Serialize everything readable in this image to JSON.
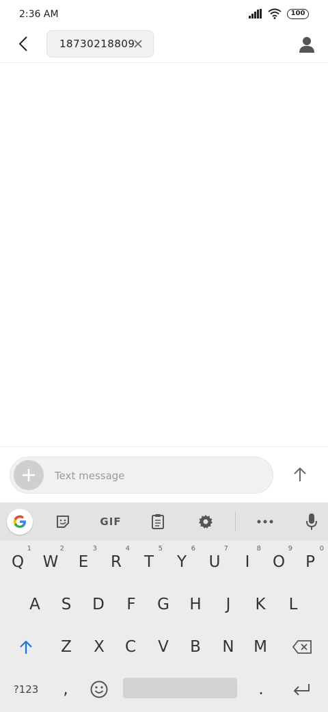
{
  "status_bar": {
    "time": "2:36 AM",
    "battery": "100"
  },
  "header": {
    "recipient": "18730218809"
  },
  "compose": {
    "placeholder": "Text message"
  },
  "keyboard": {
    "toolbar": {
      "gif_label": "GIF"
    },
    "row1": [
      {
        "letter": "Q",
        "hint": "1"
      },
      {
        "letter": "W",
        "hint": "2"
      },
      {
        "letter": "E",
        "hint": "3"
      },
      {
        "letter": "R",
        "hint": "4"
      },
      {
        "letter": "T",
        "hint": "5"
      },
      {
        "letter": "Y",
        "hint": "6"
      },
      {
        "letter": "U",
        "hint": "7"
      },
      {
        "letter": "I",
        "hint": "8"
      },
      {
        "letter": "O",
        "hint": "9"
      },
      {
        "letter": "P",
        "hint": "0"
      }
    ],
    "row2": [
      "A",
      "S",
      "D",
      "F",
      "G",
      "H",
      "J",
      "K",
      "L"
    ],
    "row3": [
      "Z",
      "X",
      "C",
      "V",
      "B",
      "N",
      "M"
    ],
    "row4": {
      "symbols": "?123",
      "comma": ",",
      "period": "."
    }
  },
  "colors": {
    "accent": "#1a73e8",
    "keyboard_bg": "#ececec",
    "toolbar_bg": "#e3e3e3"
  },
  "icons": [
    "back-arrow-icon",
    "close-icon",
    "contact-icon",
    "plus-icon",
    "send-arrow-icon",
    "google-icon",
    "sticker-icon",
    "clipboard-icon",
    "gear-icon",
    "more-icon",
    "mic-icon",
    "shift-icon",
    "backspace-icon",
    "emoji-icon",
    "enter-icon"
  ]
}
